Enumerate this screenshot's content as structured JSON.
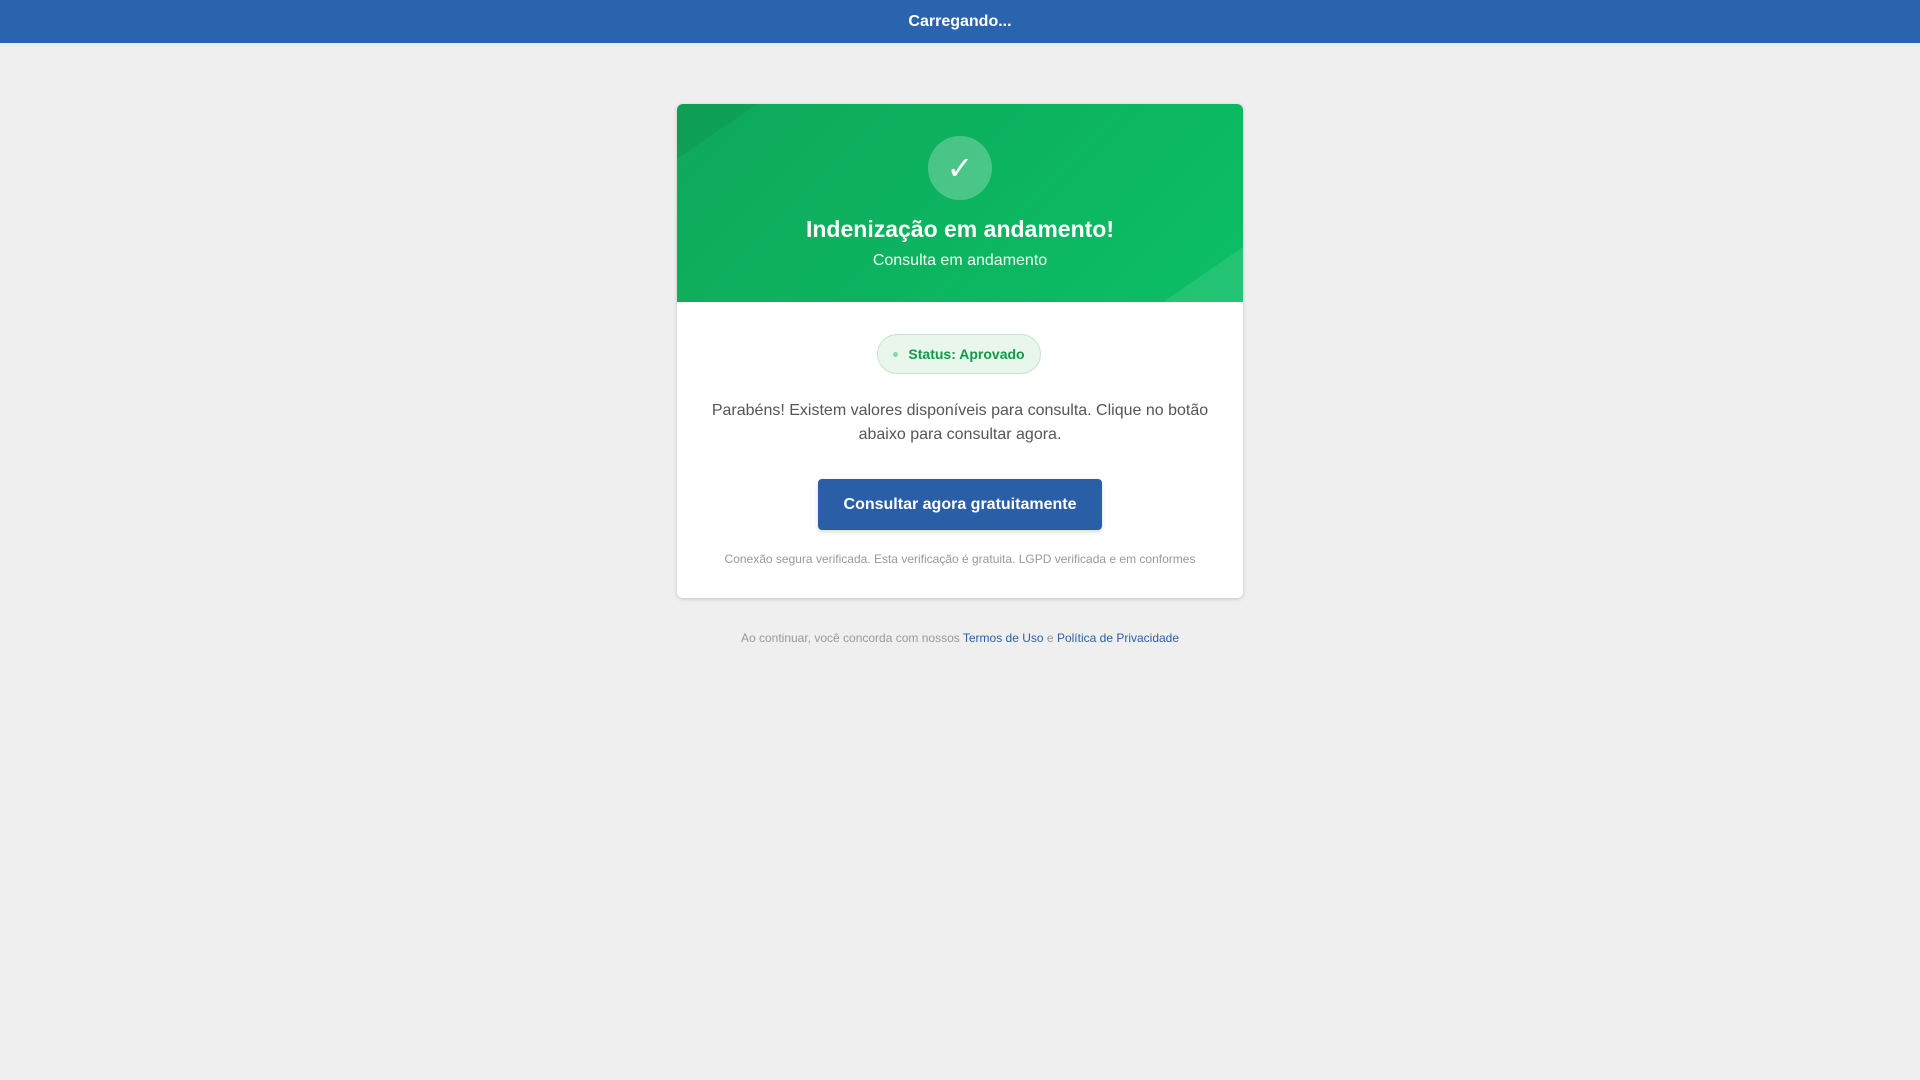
{
  "topbar": {
    "title": "Carregando..."
  },
  "header": {
    "icon": "check-icon",
    "icon_glyph": "✓",
    "title": "Indenização em andamento!",
    "subtitle": "Consulta em andamento"
  },
  "status": {
    "label": "Status: Aprovado"
  },
  "message": {
    "line1": "Parabéns! Existem valores disponíveis para consulta. Clique no botão",
    "line2": "abaixo para consultar agora."
  },
  "cta": {
    "label": "Consultar agora gratuitamente"
  },
  "secure_note": "Conexão segura verificada. Esta verificação é gratuita. LGPD verificada e em conformes",
  "footer": {
    "prefix": "Ao continuar, você concorda com nossos",
    "terms_label": "Termos de Uso",
    "conjunction": "e",
    "privacy_label": "Política de Privacidade"
  },
  "colors": {
    "topbar": "#2a63ae",
    "header_green": "#0fa85a",
    "button_blue": "#2a5fa8",
    "status_green": "#119a48",
    "background": "#efefef"
  }
}
